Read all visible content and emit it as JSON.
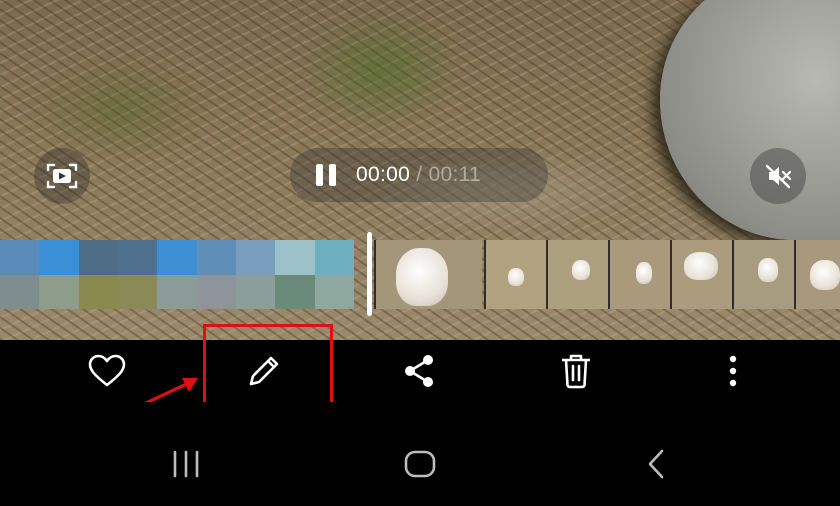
{
  "player": {
    "current_time": "00:00",
    "separator": "/",
    "total_time": "00:11",
    "playback_state": "playing",
    "muted": true
  },
  "timeline": {
    "pixelated_colors": [
      "#5a8ab8",
      "#3a8fd6",
      "#4d6e86",
      "#4e6f8d",
      "#3d8fd4",
      "#5f8eb8",
      "#7a9ec0",
      "#9cc1c8",
      "#6eb0c0",
      "#7e8e8f",
      "#8e9c8c",
      "#8a8a4e",
      "#8a8a56",
      "#8c9a98",
      "#8e949a",
      "#8c9e9a",
      "#6a8a7a",
      "#8ea8a0"
    ],
    "playhead_position": 0
  },
  "actions": {
    "favorite": "heart-icon",
    "edit": "pencil-icon",
    "share": "share-icon",
    "delete": "trash-icon",
    "more": "more-vert-icon"
  },
  "annotation": {
    "highlight_color": "#e01010",
    "arrow_color": "#e01010"
  },
  "navigation": {
    "recents": "recents-icon",
    "home": "home-icon",
    "back": "back-icon"
  }
}
